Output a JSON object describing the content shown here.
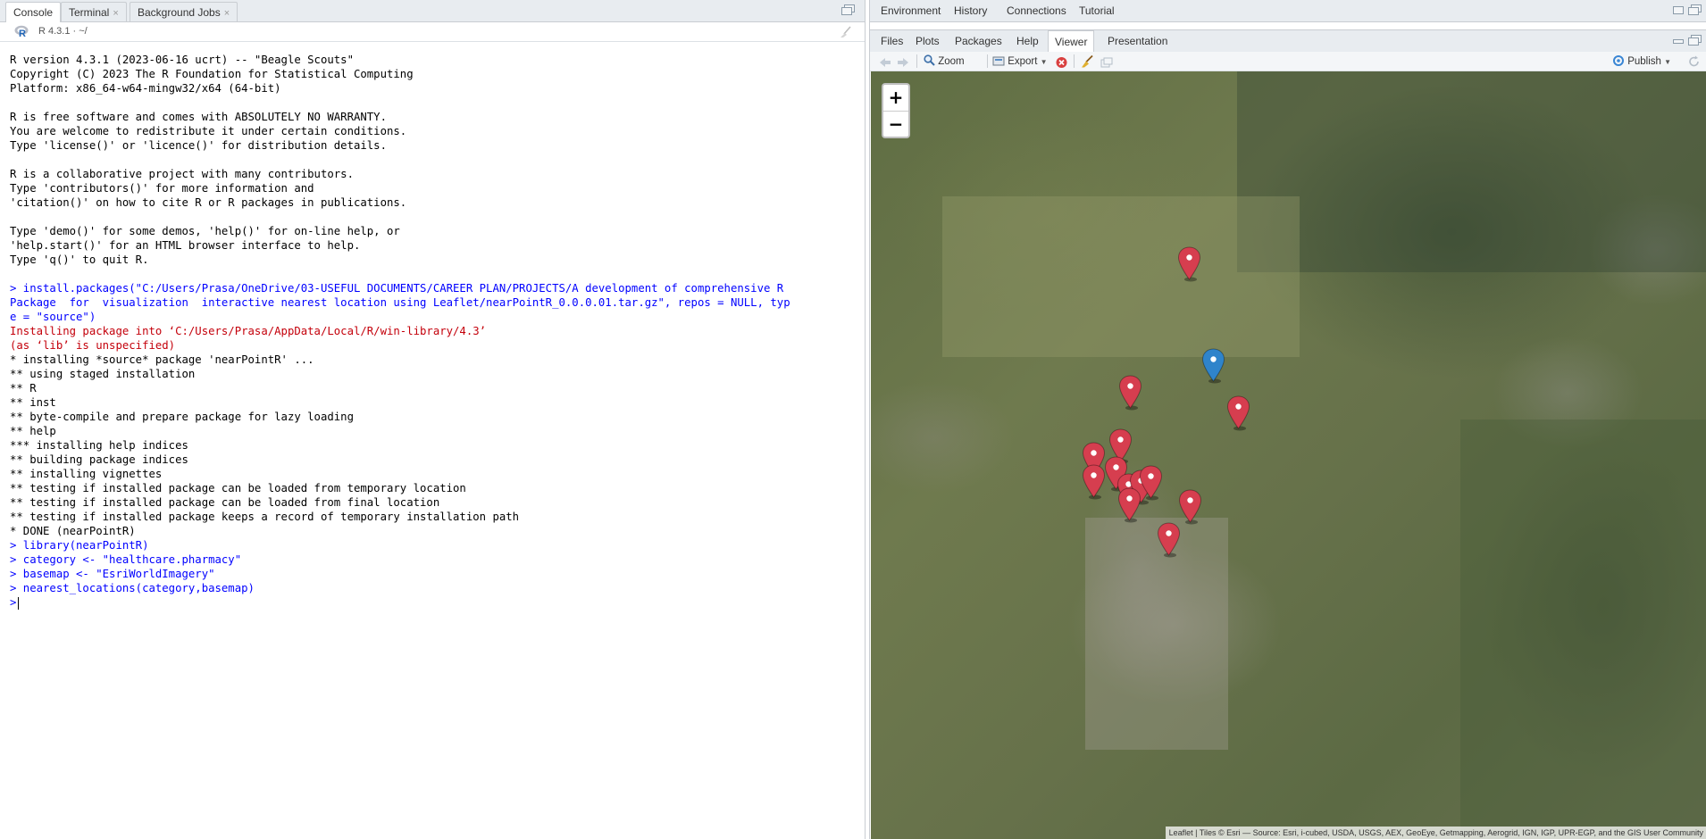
{
  "left_tabs": [
    {
      "label": "Console"
    },
    {
      "label": "Terminal"
    },
    {
      "label": "Background Jobs"
    }
  ],
  "console_bar": {
    "version": "R 4.3.1 · ~/"
  },
  "console_lines": [
    {
      "type": "out",
      "text": "R version 4.3.1 (2023-06-16 ucrt) -- \"Beagle Scouts\""
    },
    {
      "type": "out",
      "text": "Copyright (C) 2023 The R Foundation for Statistical Computing"
    },
    {
      "type": "out",
      "text": "Platform: x86_64-w64-mingw32/x64 (64-bit)"
    },
    {
      "type": "out",
      "text": ""
    },
    {
      "type": "out",
      "text": "R is free software and comes with ABSOLUTELY NO WARRANTY."
    },
    {
      "type": "out",
      "text": "You are welcome to redistribute it under certain conditions."
    },
    {
      "type": "out",
      "text": "Type 'license()' or 'licence()' for distribution details."
    },
    {
      "type": "out",
      "text": ""
    },
    {
      "type": "out",
      "text": "R is a collaborative project with many contributors."
    },
    {
      "type": "out",
      "text": "Type 'contributors()' for more information and"
    },
    {
      "type": "out",
      "text": "'citation()' on how to cite R or R packages in publications."
    },
    {
      "type": "out",
      "text": ""
    },
    {
      "type": "out",
      "text": "Type 'demo()' for some demos, 'help()' for on-line help, or"
    },
    {
      "type": "out",
      "text": "'help.start()' for an HTML browser interface to help."
    },
    {
      "type": "out",
      "text": "Type 'q()' to quit R."
    },
    {
      "type": "out",
      "text": ""
    },
    {
      "type": "in",
      "text": "> install.packages(\"C:/Users/Prasa/OneDrive/03-USEFUL DOCUMENTS/CAREER PLAN/PROJECTS/A development of comprehensive R"
    },
    {
      "type": "in",
      "text": "Package  for  visualization  interactive nearest location using Leaflet/nearPointR_0.0.0.01.tar.gz\", repos = NULL, typ"
    },
    {
      "type": "in",
      "text": "e = \"source\")"
    },
    {
      "type": "err",
      "text": "Installing package into ‘C:/Users/Prasa/AppData/Local/R/win-library/4.3’"
    },
    {
      "type": "err",
      "text": "(as ‘lib’ is unspecified)"
    },
    {
      "type": "out",
      "text": "* installing *source* package 'nearPointR' ..."
    },
    {
      "type": "out",
      "text": "** using staged installation"
    },
    {
      "type": "out",
      "text": "** R"
    },
    {
      "type": "out",
      "text": "** inst"
    },
    {
      "type": "out",
      "text": "** byte-compile and prepare package for lazy loading"
    },
    {
      "type": "out",
      "text": "** help"
    },
    {
      "type": "out",
      "text": "*** installing help indices"
    },
    {
      "type": "out",
      "text": "** building package indices"
    },
    {
      "type": "out",
      "text": "** installing vignettes"
    },
    {
      "type": "out",
      "text": "** testing if installed package can be loaded from temporary location"
    },
    {
      "type": "out",
      "text": "** testing if installed package can be loaded from final location"
    },
    {
      "type": "out",
      "text": "** testing if installed package keeps a record of temporary installation path"
    },
    {
      "type": "out",
      "text": "* DONE (nearPointR)"
    },
    {
      "type": "in",
      "text": "> library(nearPointR)"
    },
    {
      "type": "in",
      "text": "> category <- \"healthcare.pharmacy\""
    },
    {
      "type": "in",
      "text": "> basemap <- \"EsriWorldImagery\""
    },
    {
      "type": "in",
      "text": "> nearest_locations(category,basemap)"
    }
  ],
  "prompt": ">",
  "right_top_tabs": [
    {
      "label": "Environment"
    },
    {
      "label": "History"
    },
    {
      "label": "Connections"
    },
    {
      "label": "Tutorial"
    }
  ],
  "right_bottom_tabs": [
    {
      "label": "Files"
    },
    {
      "label": "Plots"
    },
    {
      "label": "Packages"
    },
    {
      "label": "Help"
    },
    {
      "label": "Viewer"
    },
    {
      "label": "Presentation"
    }
  ],
  "viewer_toolbar": {
    "zoom_label": "Zoom",
    "export_label": "Export",
    "publish_label": "Publish"
  },
  "map": {
    "zoom_in": "+",
    "zoom_out": "−",
    "attribution": "Leaflet | Tiles © Esri — Source: Esri, i-cubed, USDA, USGS, AEX, GeoEye, Getmapping, Aerogrid, IGN, IGP, UPR-EGP, and the GIS User Community",
    "markers": [
      {
        "color": "#d63e4f",
        "kind": "pharmacy"
      },
      {
        "color": "#2f84cb",
        "kind": "user-location"
      },
      {
        "color": "#d63e4f",
        "kind": "pharmacy"
      },
      {
        "color": "#d63e4f",
        "kind": "pharmacy"
      },
      {
        "color": "#d63e4f",
        "kind": "pharmacy"
      },
      {
        "color": "#d63e4f",
        "kind": "pharmacy"
      },
      {
        "color": "#d63e4f",
        "kind": "pharmacy"
      },
      {
        "color": "#d63e4f",
        "kind": "pharmacy"
      },
      {
        "color": "#d63e4f",
        "kind": "pharmacy"
      },
      {
        "color": "#d63e4f",
        "kind": "pharmacy"
      },
      {
        "color": "#d63e4f",
        "kind": "pharmacy"
      },
      {
        "color": "#d63e4f",
        "kind": "pharmacy"
      },
      {
        "color": "#d63e4f",
        "kind": "pharmacy"
      },
      {
        "color": "#d63e4f",
        "kind": "pharmacy"
      }
    ]
  }
}
